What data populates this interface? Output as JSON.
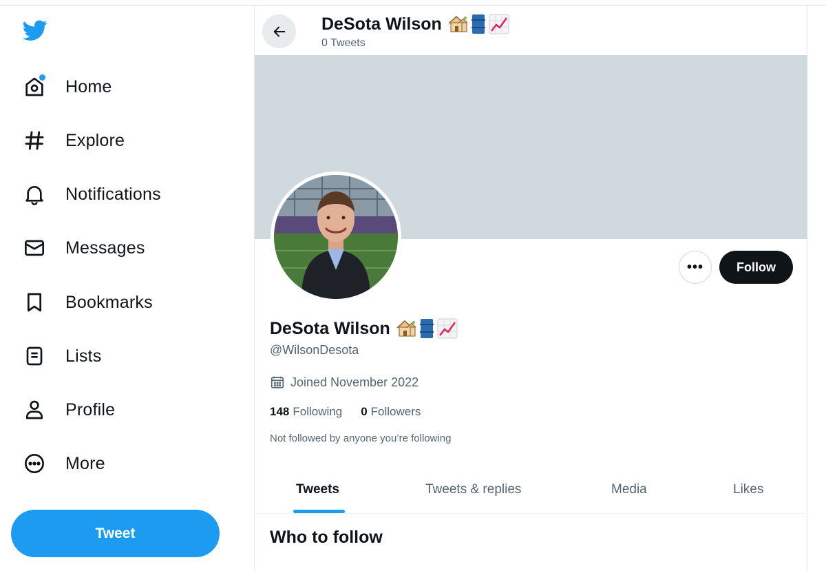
{
  "sidebar": {
    "logo_icon": "bird-logo-icon",
    "items": [
      {
        "label": "Home",
        "icon": "home-icon",
        "badge": true
      },
      {
        "label": "Explore",
        "icon": "hashtag-icon"
      },
      {
        "label": "Notifications",
        "icon": "bell-icon"
      },
      {
        "label": "Messages",
        "icon": "envelope-icon"
      },
      {
        "label": "Bookmarks",
        "icon": "bookmark-icon"
      },
      {
        "label": "Lists",
        "icon": "list-icon"
      },
      {
        "label": "Profile",
        "icon": "person-icon"
      },
      {
        "label": "More",
        "icon": "more-circle-icon"
      }
    ],
    "tweet_button": "Tweet"
  },
  "header": {
    "name": "DeSota Wilson",
    "tweet_count": "0 Tweets",
    "back_icon": "arrow-left-icon"
  },
  "profile": {
    "name": "DeSota Wilson",
    "name_emojis": [
      "house-emoji",
      "oil-drum-emoji",
      "chart-increasing-emoji"
    ],
    "handle": "@WilsonDesota",
    "joined": "Joined November 2022",
    "following_count": "148",
    "following_label": "Following",
    "followers_count": "0",
    "followers_label": "Followers",
    "not_followed": "Not followed by anyone you’re following",
    "more_label": "•••",
    "follow_label": "Follow"
  },
  "tabs": [
    "Tweets",
    "Tweets & replies",
    "Media",
    "Likes"
  ],
  "active_tab": "Tweets",
  "who_to_follow": "Who to follow",
  "colors": {
    "accent": "#1d9bf0",
    "banner": "#cfd9de",
    "text": "#0f1419",
    "muted": "#536471"
  }
}
